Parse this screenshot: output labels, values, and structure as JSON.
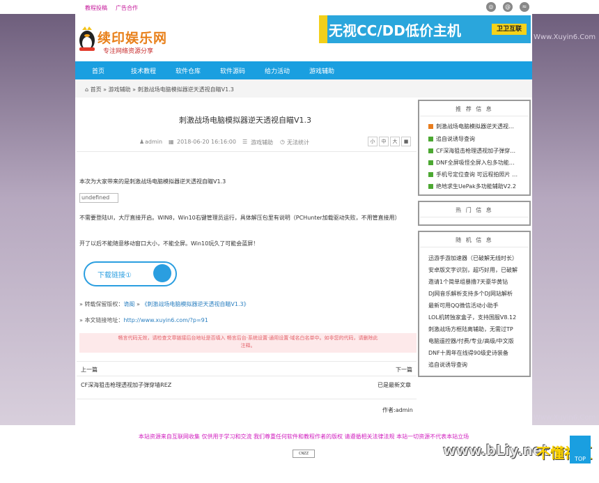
{
  "topbar": {
    "links": [
      "教程投稿",
      "广告合作"
    ]
  },
  "site": {
    "logo_title": "续印娱乐网",
    "logo_sub": "专注网络资源分享",
    "watermark_right": "Www.Xuyin6.Com"
  },
  "banner": {
    "text": "无视CC/DD低价主机",
    "badge": "卫卫互联"
  },
  "nav": {
    "items": [
      "首页",
      "技术教程",
      "软件仓库",
      "软件源码",
      "给力活动",
      "游戏辅助"
    ]
  },
  "breadcrumb": {
    "home": "首页",
    "sep": "»",
    "cat": "游戏辅助",
    "current": "刺激战场电脑模拟器逆天透视自瞄V1.3"
  },
  "article": {
    "title": "刺激战场电脑模拟器逆天透视自瞄V1.3",
    "author": "admin",
    "date": "2018-06-20 16:16:00",
    "category": "游戏辅助",
    "stats": "无法统计",
    "size_buttons": [
      "小",
      "中",
      "大",
      "■"
    ],
    "intro": "本次为大家带来的是刺激战场电脑模拟器逆天透视自瞄V1.3",
    "img_alt": "undefined",
    "p1": "不需要登陆UI，大厅直接开启。WIN8，Win10右键管理员运行，具体解压包里有说明（PCHunter加载驱动失败，不用管直接用）",
    "p2": "开了以后不能随意移动窗口大小，不能全屏。Win10玩久了可能会蓝屏！",
    "download_label": "下载链接①",
    "reprint_prefix": "» 转载保留版权：",
    "reprint_site": "诡阁",
    "reprint_sep": "»",
    "reprint_title": "《刺激战场电脑模拟器逆天透视自瞄V1.3》",
    "url_prefix": "» 本文链接地址：",
    "url": "http://www.xuyin6.com/?p=91",
    "warning_line1": "畅言代码无效，请检查文章链接后台地址是否填入 畅言后台·系统设置·通用设置·域名白名单中。如非您的代码，请删除此",
    "warning_line2": "注释。",
    "prev_label": "上一篇",
    "next_label": "下一篇",
    "prev_link": "CF深海狙击枪理透视加子弹穿墙REZ",
    "next_link": "已是最新文章",
    "author_line": "作者:admin"
  },
  "sidebar": {
    "recommend_title": "推 荐 信 息",
    "recommend_items": [
      {
        "text": "刺激战场电脑模拟器逆天透视…",
        "color": "#e87d1e"
      },
      {
        "text": "追自说诱导查询",
        "color": "#4ca832"
      },
      {
        "text": "CF深海狙击枪理透视加子弹穿…",
        "color": "#4ca832"
      },
      {
        "text": "DNF全屏吸怪全屏入包多功能…",
        "color": "#4ca832"
      },
      {
        "text": "手机号定位查询 可远程拍照片 …",
        "color": "#4ca832"
      },
      {
        "text": "绝地求生UePak多功能辅助V2.2",
        "color": "#4ca832"
      }
    ],
    "hot_title": "热 门 信 息",
    "random_title": "随 机 信 息",
    "random_items": [
      "迅游手游加速器（已破解无线时长）",
      "安卓版文字识别，超巧好用，已破解",
      "邀请1个简单组暴撸7天豪华黄钻",
      "DJ网音乐解析支持多个DJ网站解析",
      "最新可用QQ微信活动小助手",
      "LOL机转独家盒子，支持国服V8.12",
      "刺激战场方框陆离辅助，无需过TP",
      "电脑遥控器/付费/专业/高级/中文版",
      "DNF十周年在线得90级史诗装备",
      "追自说诱导查询"
    ]
  },
  "footer": {
    "text": "本站资源来自互联网收集 仅供用于学习和交流 我们尊重任何软件和教程作者的版权 请遵循相关法律法规 本站一切资源不代表本站立场",
    "cnzz": "CNZZ",
    "brand_a": "www.bLiy.net",
    "brand_b": "不懂社区",
    "totop": "TOP"
  }
}
